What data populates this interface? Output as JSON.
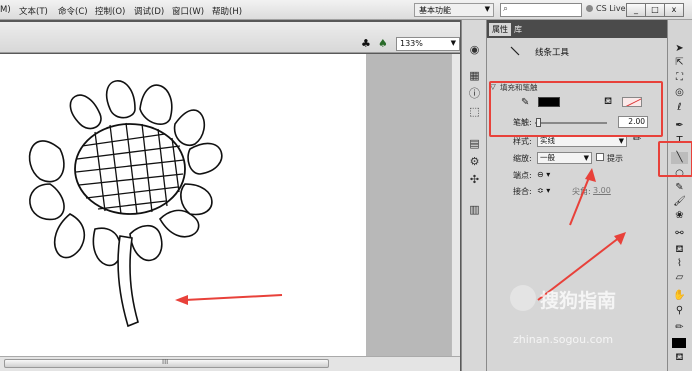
{
  "menu": {
    "items": [
      "M)",
      "文本(T)",
      "命令(C)",
      "控制(O)",
      "调试(D)",
      "窗口(W)",
      "帮助(H)"
    ],
    "workspace_label": "基本功能",
    "search_value": "",
    "cs_live": "CS Live",
    "window_buttons": [
      "_",
      "□",
      "x"
    ]
  },
  "stage": {
    "zoom": "133%",
    "scroll_grip": "III"
  },
  "panel": {
    "tabs": [
      "属性",
      "库"
    ],
    "tool_name": "线条工具",
    "section_fill_stroke": "填充和笔触",
    "stroke_label": "笔触:",
    "stroke_value": "2.00",
    "style_label": "样式:",
    "style_value": "实线",
    "scale_label": "缩放:",
    "scale_value": "一般",
    "hint_label": "提示",
    "cap_label": "端点:",
    "join_label": "接合:",
    "miter_label": "尖角:",
    "miter_value": "3.00"
  },
  "colors": {
    "annotation": "#e8413a",
    "stroke_color": "#000000"
  },
  "watermark": {
    "text": "搜狗指南",
    "url": "zhinan.sogou.com"
  }
}
